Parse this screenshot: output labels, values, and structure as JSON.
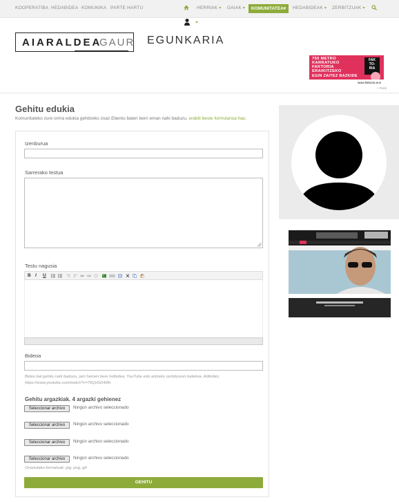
{
  "nav": {
    "items_left": [
      "KOOPERATIBA",
      "HEDABIDEA",
      "KOMUNIKA",
      "PARTE HARTU"
    ],
    "items_right": [
      "HERRIAK",
      "GAIAK",
      "KOMUNITATEA",
      "HEDABIDEAK",
      "ZERBITZUAK"
    ],
    "active": "KOMUNITATEA",
    "caret": "▾"
  },
  "logo": {
    "bold": "AIARALDEA",
    "light": "GAUR",
    "side": "EGUNKARIA"
  },
  "ad": {
    "lines": [
      "750 METRO",
      "KARRATUKO",
      "FAKTORIA",
      "ERAIKITZEKO",
      "EGIN ZAITEZ BAZKIDE"
    ],
    "box": [
      "FAK",
      "TO-",
      "RIA"
    ],
    "footer": "www.faktoria.eus",
    "pub_label": "+ Publi"
  },
  "page": {
    "title": "Gehitu edukia",
    "intro_text": "Komunitateko zure orrira edukia gehitzeko zoaz.Ebentu baten berri eman nahi baduzu, ",
    "intro_link": "erabili beste formularioa hau."
  },
  "form": {
    "title_label": "Izenburua",
    "title_value": "",
    "lead_label": "Sarrerako testua",
    "lead_value": "",
    "body_label": "Testu nagusia",
    "toolbar": {
      "bold": "B",
      "italic": "I",
      "underline": "U"
    },
    "video_label": "Bideoa",
    "video_value": "",
    "video_hint": "Bideo bat gehitu nahi baduzu, jarri hemen bere helbidea, YouTube edo antzeko zerbitzuren batekoa. Adibidez, https://www.youtube.com/watch?v=76QvGD4tIfo",
    "images_label": "Gehitu argazkiak. 4 argazki gehienez",
    "file_button": "Seleccionar archivo",
    "file_status": "Ningún archivo seleccionado",
    "formats": "Onartutako formatuak: jpg, png, gif.",
    "submit": "GEHITU"
  },
  "colors": {
    "accent": "#8dab3a",
    "ad": "#e0315c"
  }
}
